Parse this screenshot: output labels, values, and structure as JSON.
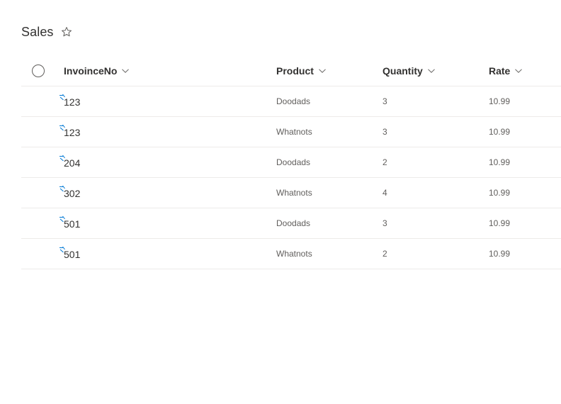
{
  "page": {
    "title": "Sales",
    "favorite_icon": "star-outline-icon"
  },
  "grid": {
    "columns": [
      {
        "key": "invoice",
        "label": "InvoinceNo"
      },
      {
        "key": "product",
        "label": "Product"
      },
      {
        "key": "quantity",
        "label": "Quantity"
      },
      {
        "key": "rate",
        "label": "Rate"
      }
    ],
    "rows": [
      {
        "invoice": "123",
        "product": "Doodads",
        "quantity": "3",
        "rate": "10.99",
        "is_new": true
      },
      {
        "invoice": "123",
        "product": "Whatnots",
        "quantity": "3",
        "rate": "10.99",
        "is_new": true
      },
      {
        "invoice": "204",
        "product": "Doodads",
        "quantity": "2",
        "rate": "10.99",
        "is_new": true
      },
      {
        "invoice": "302",
        "product": "Whatnots",
        "quantity": "4",
        "rate": "10.99",
        "is_new": true
      },
      {
        "invoice": "501",
        "product": "Doodads",
        "quantity": "3",
        "rate": "10.99",
        "is_new": true
      },
      {
        "invoice": "501",
        "product": "Whatnots",
        "quantity": "2",
        "rate": "10.99",
        "is_new": true
      }
    ]
  },
  "colors": {
    "accent": "#0078d4",
    "text_primary": "#323130",
    "text_secondary": "#605e5c",
    "divider": "#edebe9"
  }
}
